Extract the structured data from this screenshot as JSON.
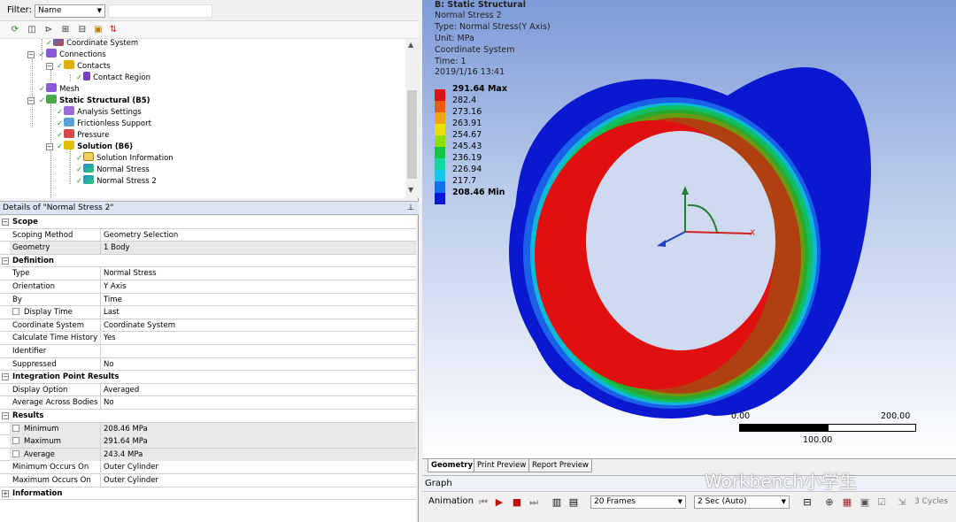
{
  "filter": {
    "label": "Filter:",
    "value": "Name"
  },
  "tree": [
    {
      "label": "Coordinate System"
    },
    {
      "label": "Connections"
    },
    {
      "label": "Contacts"
    },
    {
      "label": "Contact Region"
    },
    {
      "label": "Mesh"
    },
    {
      "label": "Static Structural (B5)"
    },
    {
      "label": "Analysis Settings"
    },
    {
      "label": "Frictionless Support"
    },
    {
      "label": "Pressure"
    },
    {
      "label": "Solution (B6)"
    },
    {
      "label": "Solution Information"
    },
    {
      "label": "Normal Stress"
    },
    {
      "label": "Normal Stress 2"
    }
  ],
  "details_title": "Details of \"Normal Stress 2\"",
  "details_pin": "q",
  "details": [
    {
      "section": "Scope"
    },
    {
      "key": "Scoping Method",
      "value": "Geometry Selection"
    },
    {
      "key": "Geometry",
      "value": "1 Body"
    },
    {
      "section": "Definition"
    },
    {
      "key": "Type",
      "value": "Normal Stress"
    },
    {
      "key": "Orientation",
      "value": "Y Axis"
    },
    {
      "key": "By",
      "value": "Time"
    },
    {
      "key": "Display Time",
      "value": "Last"
    },
    {
      "key": "Coordinate System",
      "value": "Coordinate System"
    },
    {
      "key": "Calculate Time History",
      "value": "Yes"
    },
    {
      "key": "Identifier",
      "value": ""
    },
    {
      "key": "Suppressed",
      "value": "No"
    },
    {
      "section": "Integration Point Results"
    },
    {
      "key": "Display Option",
      "value": "Averaged"
    },
    {
      "key": "Average Across Bodies",
      "value": "No"
    },
    {
      "section": "Results"
    },
    {
      "key": "Minimum",
      "value": "208.46 MPa"
    },
    {
      "key": "Maximum",
      "value": "291.64 MPa"
    },
    {
      "key": "Average",
      "value": "243.4 MPa"
    },
    {
      "key": "Minimum Occurs On",
      "value": "Outer Cylinder"
    },
    {
      "key": "Maximum Occurs On",
      "value": "Outer Cylinder"
    },
    {
      "section": "Information"
    }
  ],
  "viewport": {
    "title": "B: Static Structural",
    "result_name": "Normal Stress 2",
    "type_line": "Type: Normal Stress(Y Axis)",
    "unit_line": "Unit: MPa",
    "cs_line": "Coordinate System",
    "time_line": "Time: 1",
    "date_line": "2019/1/16 13:41",
    "legend": [
      {
        "label": "291.64 Max",
        "color": "#e01010"
      },
      {
        "label": "282.4",
        "color": "#f05a10"
      },
      {
        "label": "273.16",
        "color": "#f5a510"
      },
      {
        "label": "263.91",
        "color": "#e8e000"
      },
      {
        "label": "254.67",
        "color": "#8ee000"
      },
      {
        "label": "245.43",
        "color": "#10c840"
      },
      {
        "label": "236.19",
        "color": "#10d8a0"
      },
      {
        "label": "226.94",
        "color": "#10c8e8"
      },
      {
        "label": "217.7",
        "color": "#1070f0"
      },
      {
        "label": "208.46 Min",
        "color": "#0018d8"
      }
    ],
    "scale": {
      "left": "0.00",
      "right": "200.00",
      "mid": "100.00"
    },
    "axis_x": "X"
  },
  "tabs": [
    "Geometry",
    "Print Preview",
    "Report Preview"
  ],
  "graph": {
    "title": "Graph"
  },
  "animation": {
    "label": "Animation",
    "frames": "20 Frames",
    "duration": "2 Sec (Auto)",
    "cycles": "3 Cycles"
  },
  "watermark": "Workbench小学生"
}
